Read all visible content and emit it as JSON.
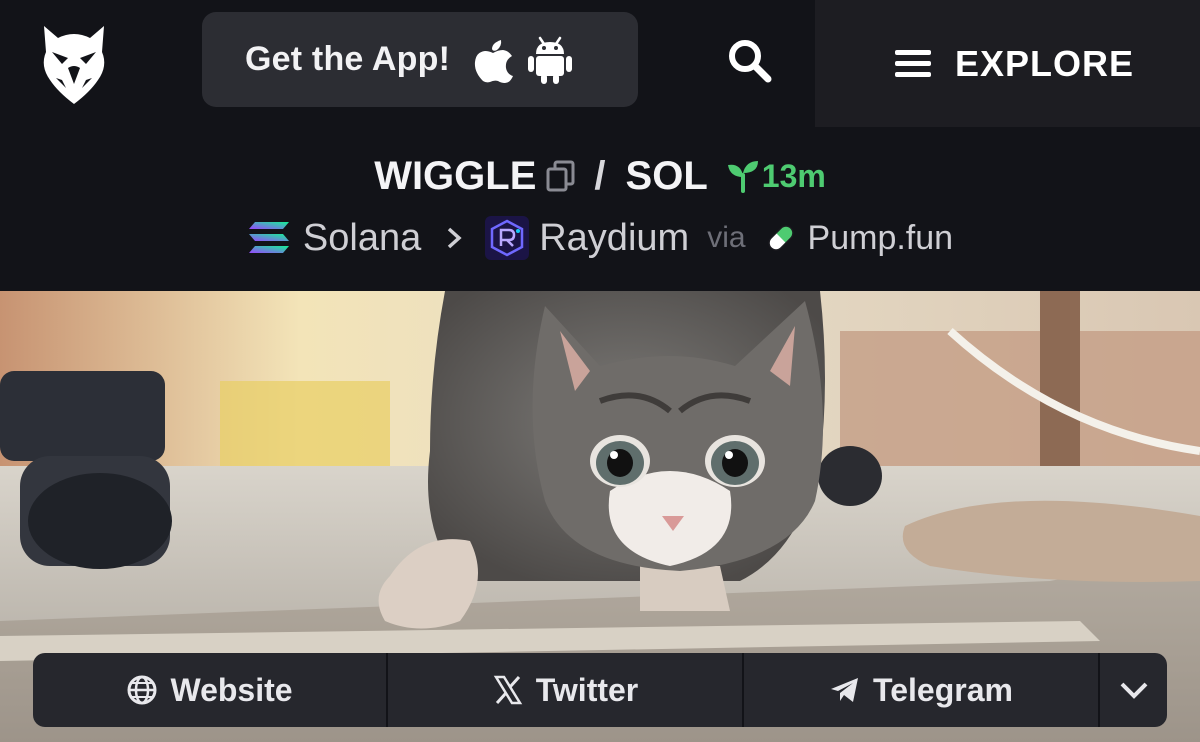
{
  "header": {
    "app_button_label": "Get the App!",
    "explore_label": "EXPLORE",
    "icons": [
      "eagle-logo-icon",
      "apple-icon",
      "android-icon",
      "search-icon",
      "menu-icon"
    ]
  },
  "pair": {
    "base_token": "WIGGLE",
    "separator": "/",
    "quote_token": "SOL",
    "age": "13m",
    "age_color": "#4ecb71"
  },
  "route": {
    "chain": "Solana",
    "dex": "Raydium",
    "via_label": "via",
    "launchpad": "Pump.fun"
  },
  "links": {
    "website": "Website",
    "twitter": "Twitter",
    "telegram": "Telegram"
  },
  "colors": {
    "background": "#121318",
    "button_bg": "#2c2d33",
    "explore_bg": "#1d1d22"
  }
}
